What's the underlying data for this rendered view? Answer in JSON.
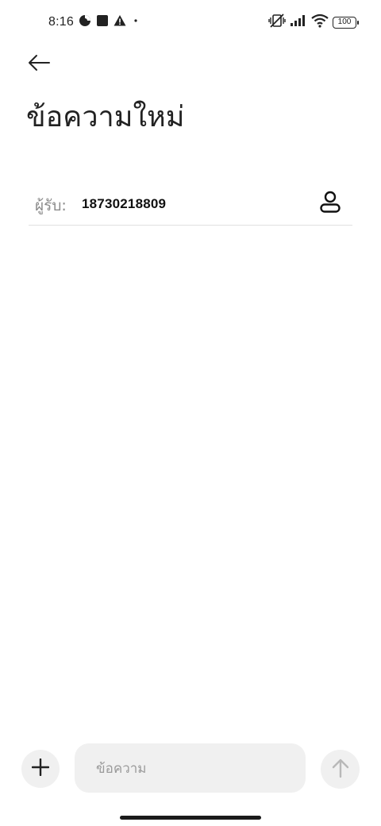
{
  "status_bar": {
    "time": "8:16",
    "left_icons": [
      "data-saver-icon",
      "square-notification-icon",
      "warning-icon",
      "dot-icon"
    ],
    "right_icons": [
      "vibrate-off-icon",
      "signal-icon",
      "wifi-icon"
    ],
    "battery": "100"
  },
  "header": {
    "back_icon": "arrow-left-icon",
    "title": "ข้อความใหม่"
  },
  "recipient": {
    "label": "ผู้รับ:",
    "value": "18730218809",
    "contact_icon": "person-icon"
  },
  "composer": {
    "attach_icon": "plus-icon",
    "placeholder": "ข้อความ",
    "send_icon": "arrow-up-icon"
  },
  "colors": {
    "background": "#ffffff",
    "text": "#222222",
    "muted": "#8a8a8a",
    "field": "#f0f0f0",
    "divider": "#e0e0e0"
  }
}
